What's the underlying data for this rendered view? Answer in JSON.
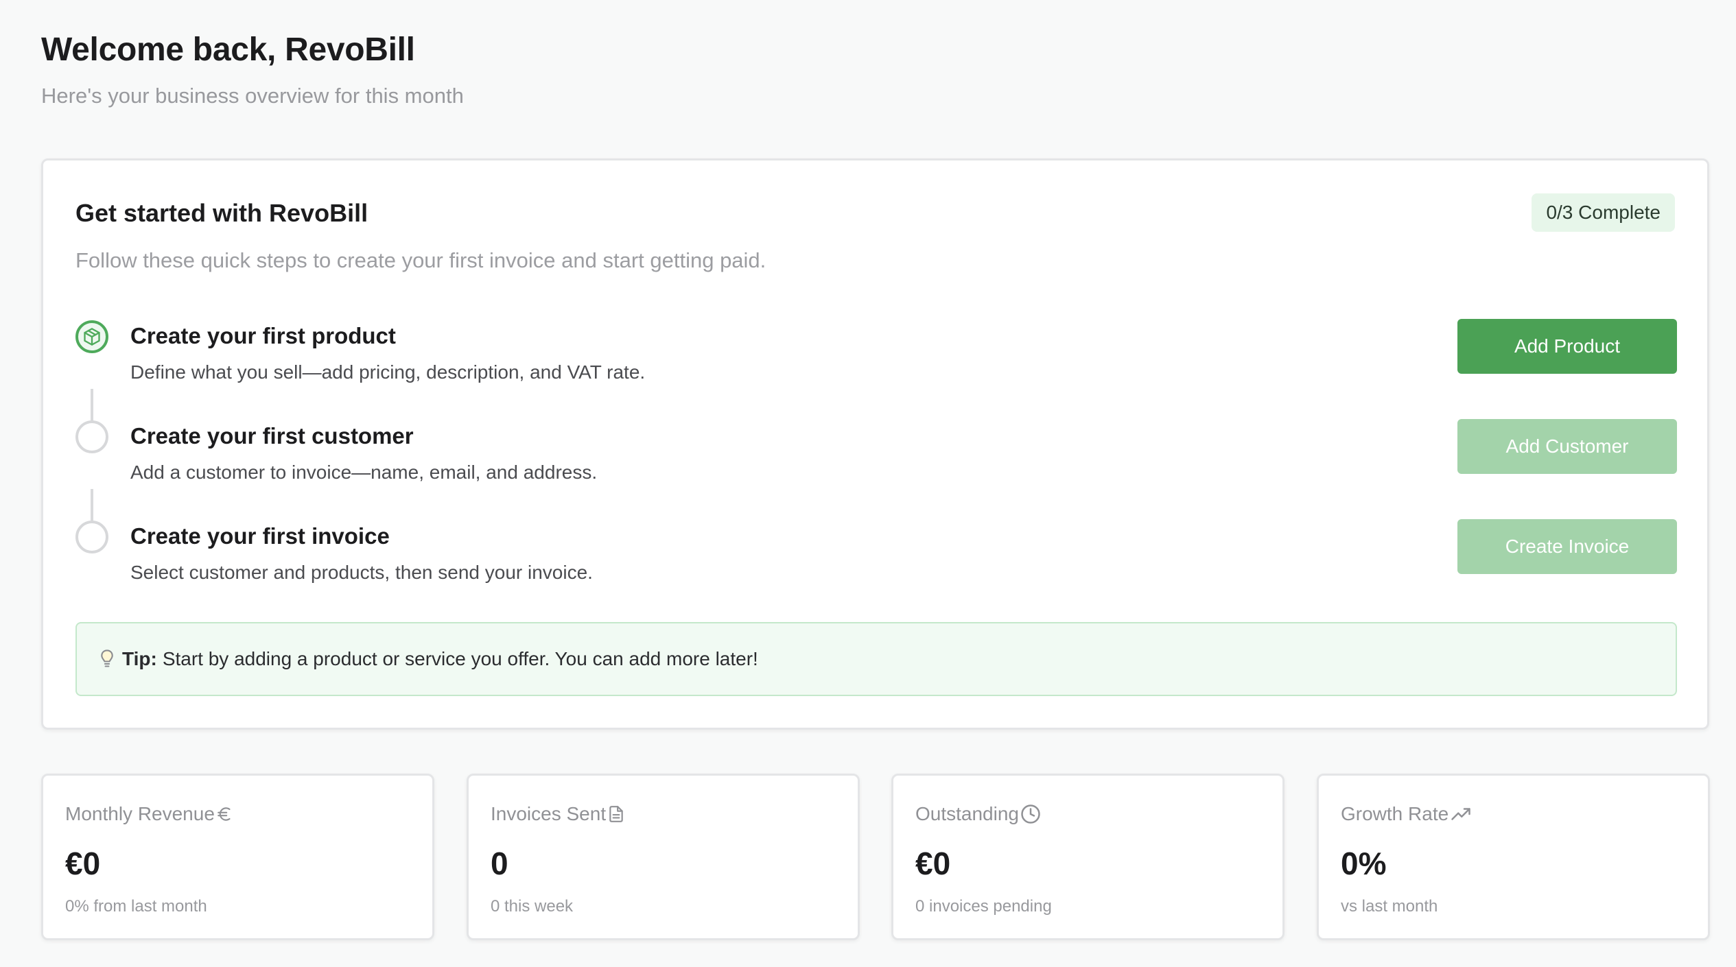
{
  "header": {
    "title": "Welcome back, RevoBill",
    "subtitle": "Here's your business overview for this month"
  },
  "onboarding": {
    "title": "Get started with RevoBill",
    "subtitle": "Follow these quick steps to create your first invoice and start getting paid.",
    "progress_badge": "0/3 Complete",
    "steps": [
      {
        "title": "Create your first product",
        "description": "Define what you sell—add pricing, description, and VAT rate.",
        "button_label": "Add Product",
        "icon": "package-icon",
        "state": "active"
      },
      {
        "title": "Create your first customer",
        "description": "Add a customer to invoice—name, email, and address.",
        "button_label": "Add Customer",
        "state": "disabled"
      },
      {
        "title": "Create your first invoice",
        "description": "Select customer and products, then send your invoice.",
        "button_label": "Create Invoice",
        "state": "disabled"
      }
    ],
    "tip": {
      "icon": "lightbulb-icon",
      "label": "Tip:",
      "text": "Start by adding a product or service you offer. You can add more later!"
    }
  },
  "stats": [
    {
      "label": "Monthly Revenue",
      "icon": "euro-icon",
      "value": "€0",
      "note": "0% from last month"
    },
    {
      "label": "Invoices Sent",
      "icon": "document-icon",
      "value": "0",
      "note": "0 this week"
    },
    {
      "label": "Outstanding",
      "icon": "clock-icon",
      "value": "€0",
      "note": "0 invoices pending"
    },
    {
      "label": "Growth Rate",
      "icon": "trending-up-icon",
      "value": "0%",
      "note": "vs last month"
    }
  ],
  "colors": {
    "accent": "#4ba155",
    "accent_disabled": "#a3d3aa",
    "badge_bg": "#e7f6ea",
    "tip_bg": "#f1faf3",
    "tip_border": "#c4e8cb",
    "page_bg": "#f8f9f9"
  }
}
